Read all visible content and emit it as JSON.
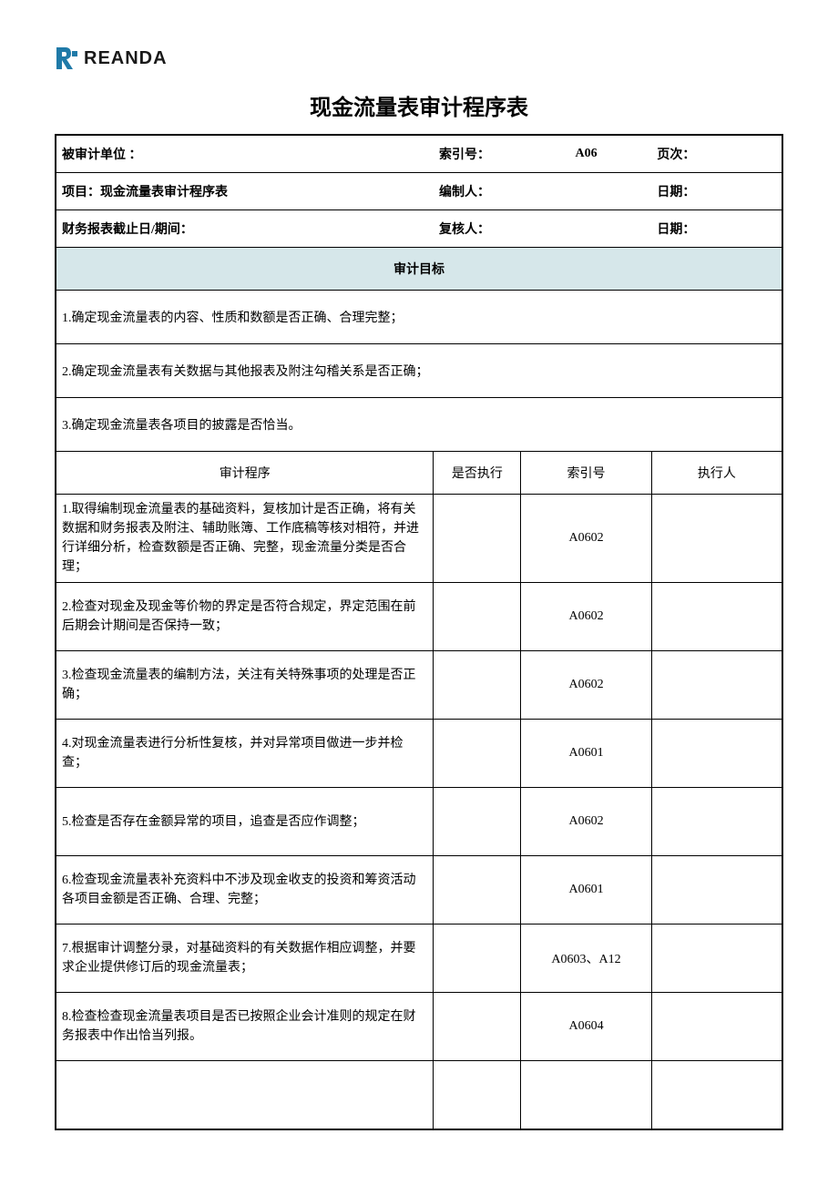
{
  "brand": "REANDA",
  "title": "现金流量表审计程序表",
  "header": {
    "row1": {
      "unit_label": "被审计单位 ：",
      "unit_value": "",
      "index_label": "索引号：",
      "index_value": "A06",
      "page_label": "页次：",
      "page_value": ""
    },
    "row2": {
      "project_label": "项目：现金流量表审计程序表",
      "project_value": "",
      "preparer_label": "编制人：",
      "preparer_value": "",
      "date1_label": "日期：",
      "date1_value": ""
    },
    "row3": {
      "period_label": "财务报表截止日/期间：",
      "period_value": "",
      "reviewer_label": "复核人：",
      "reviewer_value": "",
      "date2_label": "日期：",
      "date2_value": ""
    }
  },
  "objectives_header": "审计目标",
  "objectives": [
    "1.确定现金流量表的内容、性质和数额是否正确、合理完整；",
    "2.确定现金流量表有关数据与其他报表及附注勾稽关系是否正确；",
    "3.确定现金流量表各项目的披露是否恰当。"
  ],
  "proc_headers": {
    "procedure": "审计程序",
    "execute": "是否执行",
    "index": "索引号",
    "executor": "执行人"
  },
  "procedures": [
    {
      "text": "1.取得编制现金流量表的基础资料，复核加计是否正确，将有关数据和财务报表及附注、辅助账簿、工作底稿等核对相符，并进行详细分析，检查数额是否正确、完整，现金流量分类是否合理；",
      "execute": "",
      "index": "A0602",
      "executor": ""
    },
    {
      "text": "2.检查对现金及现金等价物的界定是否符合规定，界定范围在前后期会计期间是否保持一致；",
      "execute": "",
      "index": "A0602",
      "executor": ""
    },
    {
      "text": "3.检查现金流量表的编制方法，关注有关特殊事项的处理是否正确；",
      "execute": "",
      "index": "A0602",
      "executor": ""
    },
    {
      "text": "4.对现金流量表进行分析性复核，并对异常项目做进一步并检查；",
      "execute": "",
      "index": "A0601",
      "executor": ""
    },
    {
      "text": "5.检查是否存在金额异常的项目，追查是否应作调整；",
      "execute": "",
      "index": "A0602",
      "executor": ""
    },
    {
      "text": "6.检查现金流量表补充资料中不涉及现金收支的投资和筹资活动各项目金额是否正确、合理、完整；",
      "execute": "",
      "index": "A0601",
      "executor": ""
    },
    {
      "text": "7.根据审计调整分录，对基础资料的有关数据作相应调整，并要求企业提供修订后的现金流量表；",
      "execute": "",
      "index": "A0603、A12",
      "executor": ""
    },
    {
      "text": "8.检查检查现金流量表项目是否已按照企业会计准则的规定在财务报表中作出恰当列报。",
      "execute": "",
      "index": "A0604",
      "executor": ""
    },
    {
      "text": "",
      "execute": "",
      "index": "",
      "executor": ""
    }
  ]
}
